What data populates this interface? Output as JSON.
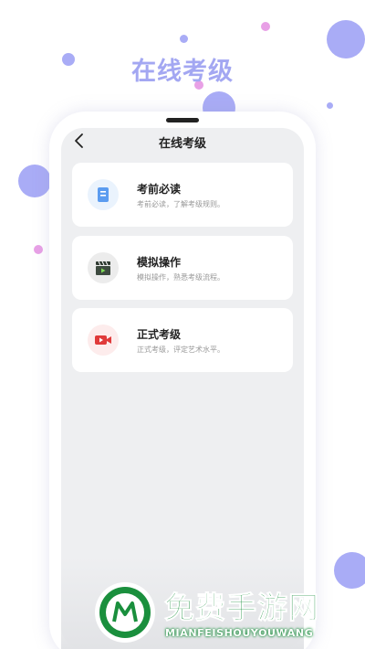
{
  "headline": "在线考级",
  "nav": {
    "title": "在线考级"
  },
  "cards": [
    {
      "title": "考前必读",
      "desc": "考前必读，了解考级规则。",
      "icon": "document-icon",
      "icon_color": "#5b9cf0",
      "icon_bg": "#eaf3fd"
    },
    {
      "title": "模拟操作",
      "desc": "模拟操作，熟悉考级流程。",
      "icon": "clapperboard-icon",
      "icon_color": "#3d4a3f",
      "icon_bg": "#ececec"
    },
    {
      "title": "正式考级",
      "desc": "正式考级，评定艺术水平。",
      "icon": "video-camera-icon",
      "icon_color": "#e03a3a",
      "icon_bg": "#fdecec"
    }
  ],
  "watermark": {
    "title": "免费手游网",
    "subtitle": "MIANFEISHOUYOUWANG"
  },
  "colors": {
    "accent": "#a3a7f2",
    "dot_purple": "#a9acf6",
    "dot_pink": "#e8a0e6",
    "watermark_green": "#1a8f3d"
  }
}
